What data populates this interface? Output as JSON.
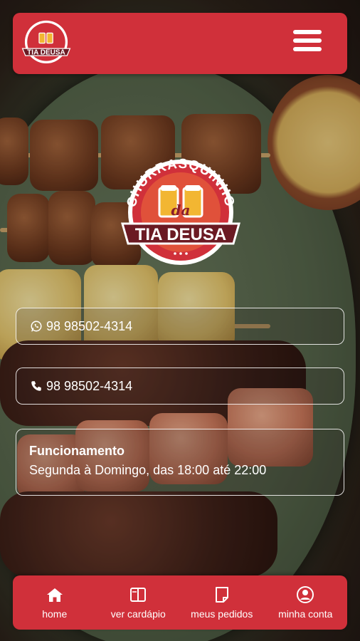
{
  "brand": {
    "top_line": "CHURRASQUINHO",
    "script_word": "da",
    "name": "TIA DEUSA",
    "colors": {
      "primary": "#d0303a",
      "banner": "#6b1a23",
      "beer": "#f2b632"
    }
  },
  "header": {
    "menu_icon": "hamburger-menu-icon"
  },
  "contacts": [
    {
      "icon": "whatsapp-icon",
      "label": "98 98502-4314"
    },
    {
      "icon": "phone-icon",
      "label": "98 98502-4314"
    }
  ],
  "hours": {
    "title": "Funcionamento",
    "text": "Segunda à Domingo, das 18:00 até 22:00"
  },
  "nav": [
    {
      "icon": "home-icon",
      "label": "home"
    },
    {
      "icon": "menu-book-icon",
      "label": "ver cardápio"
    },
    {
      "icon": "orders-icon",
      "label": "meus pedidos"
    },
    {
      "icon": "account-icon",
      "label": "minha conta"
    }
  ]
}
